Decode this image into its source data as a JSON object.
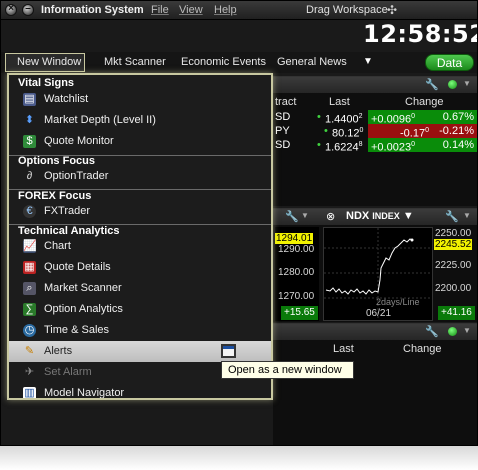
{
  "titlebar": {
    "title": "Information System",
    "menus": [
      "File",
      "View",
      "Help"
    ],
    "drag_workspace": "Drag Workspace",
    "drag_glyph": "✣"
  },
  "clock": "12:58:52",
  "toolbar": {
    "items": [
      "New Window",
      "Mkt Scanner",
      "Economic Events",
      "General News"
    ],
    "more_glyph": "▼",
    "data_button": "Data"
  },
  "quotes_panel": {
    "columns": [
      "tract",
      "Last",
      "Change"
    ],
    "rows": [
      {
        "sym": "SD",
        "last": "1.4400",
        "last_sup": "2",
        "change": "+0.0096",
        "change_sup": "0",
        "pct": "0.67%",
        "tone": "green"
      },
      {
        "sym": "PY",
        "last": "80.12",
        "last_sup": "0",
        "change": "-0.17",
        "change_sup": "0",
        "pct": "-0.21%",
        "tone": "red"
      },
      {
        "sym": "SD",
        "last": "1.6224",
        "last_sup": "8",
        "change": "+0.0023",
        "change_sup": "0",
        "pct": "0.14%",
        "tone": "green"
      }
    ]
  },
  "chart_panel": {
    "title": "NDX",
    "title_suffix": "INDEX",
    "left_axis": [
      "1294.01",
      "1290.00",
      "1280.00",
      "1270.00"
    ],
    "left_change": "+15.65",
    "right_axis": [
      "2250.00",
      "2245.52",
      "2225.00",
      "2200.00"
    ],
    "right_change": "+41.16",
    "period": "2days/Line",
    "date": "06/21"
  },
  "bottom_panel": {
    "columns": [
      "Last",
      "Change"
    ]
  },
  "menu": {
    "sections": [
      {
        "title": "Vital Signs",
        "items": [
          {
            "label": "Watchlist",
            "icon": "watchlist-icon"
          },
          {
            "label": "Market Depth (Level II)",
            "icon": "market-depth-icon"
          },
          {
            "label": "Quote Monitor",
            "icon": "quote-monitor-icon"
          }
        ]
      },
      {
        "title": "Options Focus",
        "items": [
          {
            "label": "OptionTrader",
            "icon": "option-trader-icon"
          }
        ]
      },
      {
        "title": "FOREX Focus",
        "items": [
          {
            "label": "FXTrader",
            "icon": "fx-trader-icon"
          }
        ]
      },
      {
        "title": "Technical Analytics",
        "items": [
          {
            "label": "Chart",
            "icon": "chart-icon"
          },
          {
            "label": "Quote Details",
            "icon": "quote-details-icon"
          },
          {
            "label": "Market Scanner",
            "icon": "market-scanner-icon"
          },
          {
            "label": "Option Analytics",
            "icon": "option-analytics-icon"
          },
          {
            "label": "Time & Sales",
            "icon": "time-sales-icon"
          },
          {
            "label": "Alerts",
            "icon": "alerts-icon"
          },
          {
            "label": "Set Alarm",
            "icon": "set-alarm-icon"
          },
          {
            "label": "Model Navigator",
            "icon": "model-navigator-icon"
          }
        ]
      }
    ],
    "tooltip": "Open as a new window"
  },
  "colors": {
    "accent_green": "#1b8a1b",
    "up": "#0a8c0a",
    "down": "#9a0f0f",
    "highlight_yellow": "#f2f200"
  }
}
